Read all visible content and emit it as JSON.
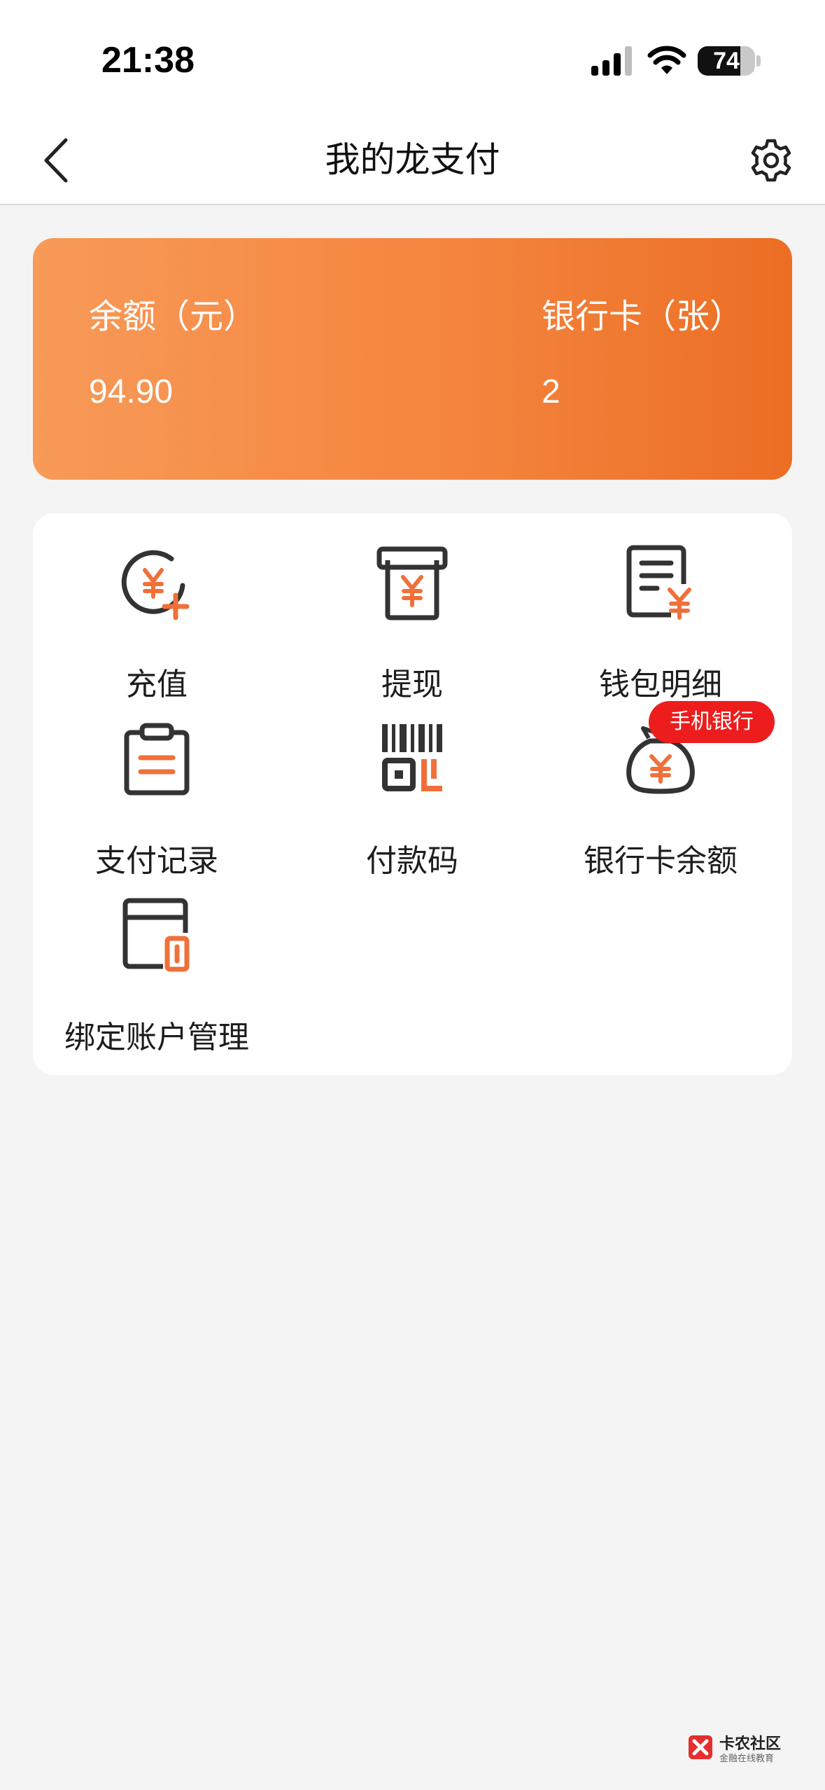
{
  "status_bar": {
    "time": "21:38",
    "battery_level": "74",
    "battery_percent": 74
  },
  "nav": {
    "title": "我的龙支付"
  },
  "summary": {
    "balance_label": "余额（元）",
    "balance_value": "94.90",
    "cards_label": "银行卡（张）",
    "cards_value": "2"
  },
  "menu": {
    "items": [
      {
        "label": "充值",
        "icon": "recharge-icon"
      },
      {
        "label": "提现",
        "icon": "withdraw-icon"
      },
      {
        "label": "钱包明细",
        "icon": "wallet-details-icon"
      },
      {
        "label": "支付记录",
        "icon": "payment-records-icon"
      },
      {
        "label": "付款码",
        "icon": "payment-code-icon"
      },
      {
        "label": "银行卡余额",
        "icon": "money-bag-icon",
        "badge": "手机银行"
      },
      {
        "label": "绑定账户管理",
        "icon": "bind-account-icon"
      }
    ]
  },
  "watermark": {
    "title": "卡农社区",
    "subtitle": "金融在线教育"
  },
  "colors": {
    "accent": "#F4853F",
    "icon_dark": "#333333",
    "badge": "#EE1D1D"
  }
}
